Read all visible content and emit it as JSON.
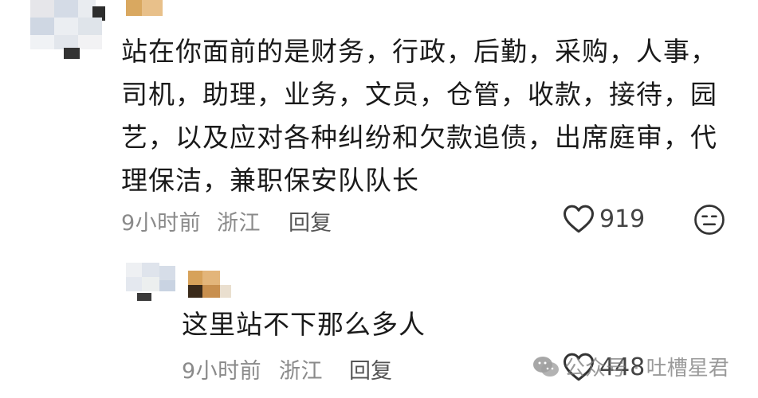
{
  "comments": [
    {
      "text": "站在你面前的是财务，行政，后勤，采购，人事，司机，助理，业务，文员，仓管，收款，接待，园艺，以及应对各种纠纷和欠款追债，出席庭审，代理保洁，兼职保安队队长",
      "time": "9小时前",
      "location": "浙江",
      "reply_label": "回复",
      "likes": "919",
      "icons": {
        "like": "heart-outline-icon",
        "dislike": "neutral-face-icon"
      }
    },
    {
      "text": "这里站不下那么多人",
      "time": "9小时前",
      "location": "浙江",
      "reply_label": "回复",
      "likes": "448",
      "icons": {
        "like": "heart-outline-icon"
      }
    }
  ],
  "watermark": {
    "text": "公众号 · 吐槽星君",
    "icon": "wechat-icon"
  },
  "colors": {
    "text": "#1a1a1a",
    "meta": "#8a8a8a",
    "background": "#ffffff"
  }
}
